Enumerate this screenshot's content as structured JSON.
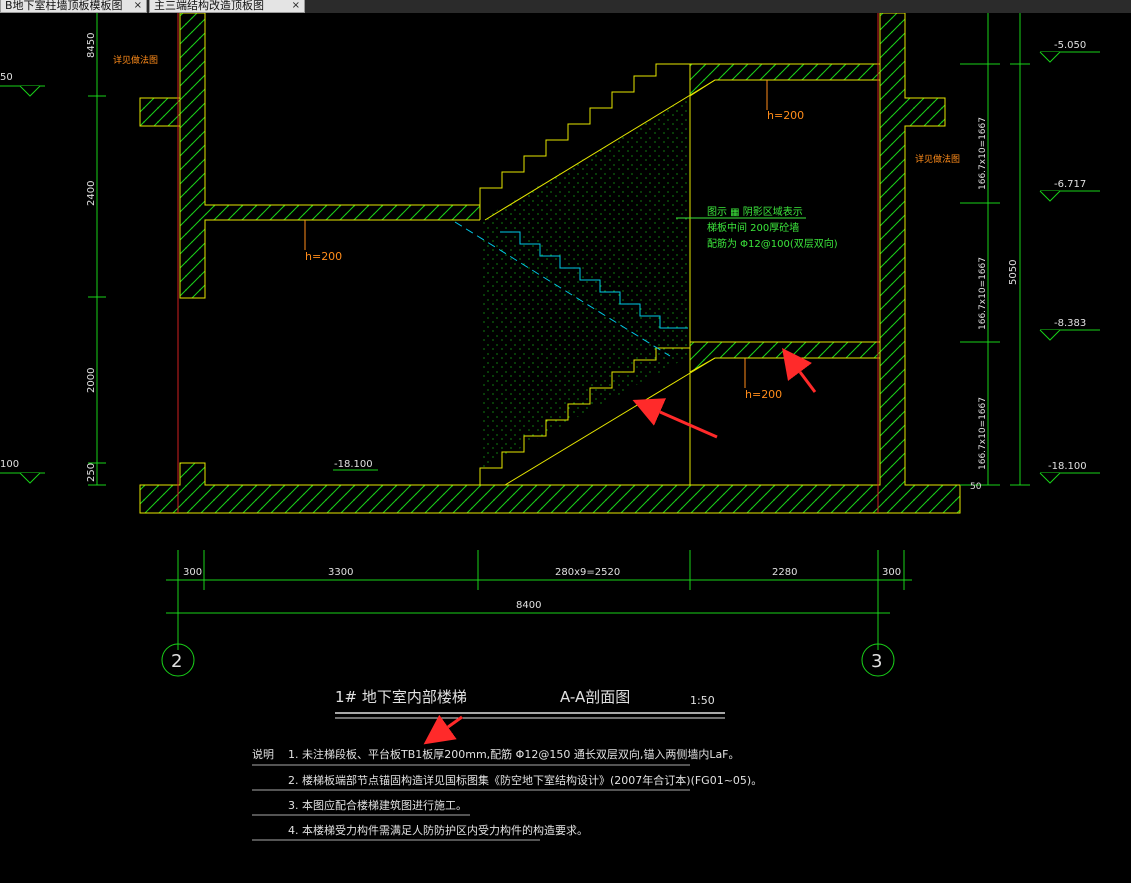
{
  "tabs": [
    {
      "label": "B地下室柱墙顶板模板图",
      "close": "×"
    },
    {
      "label": "主三端结构改造顶板图",
      "close": "×"
    }
  ],
  "colors": {
    "background": "#000000",
    "green_lines": "#19d219",
    "wall_yellow": "#e6e600",
    "dim_text": "#e0e0e0",
    "orange_text": "#ff8c1a",
    "cyan_dashed": "#00c8e6",
    "axis_red": "#d02020",
    "arrow_red": "#ff2a2a",
    "note_green": "#3ce63c"
  },
  "drawing": {
    "elevations": [
      "-5.050",
      "-6.717",
      "-8.383",
      "-18.100"
    ],
    "left_elev_top": "50",
    "left_elev_bottom": "100",
    "left_dims": [
      "8450",
      "2400",
      "2000",
      "250"
    ],
    "right_dims": [
      "166.7x10=1667",
      "166.7x10=1667",
      "166.7x10=1667",
      "5050",
      "50"
    ],
    "floor_level": "-18.100",
    "slab_labels": [
      "h=200",
      "h=200",
      "h=200"
    ],
    "detail_labels": [
      "详见做法图",
      "详见做法图"
    ],
    "fill_note": [
      "图示 ▦ 阴影区域表示",
      "梯板中间 200厚砼墙",
      "配筋为 Φ12@100(双层双向)"
    ],
    "bottom_dims": [
      "300",
      "3300",
      "280x9=2520",
      "2280",
      "300"
    ],
    "total_dim": "8400",
    "axes": [
      "2",
      "3"
    ],
    "title_left": "1# 地下室内部楼梯",
    "title_mid": "A-A剖面图",
    "title_scale": "1:50",
    "notes_head": "说明",
    "notes": [
      "1. 未注梯段板、平台板TB1板厚200mm,配筋 Φ12@150 通长双层双向,锚入两侧墙内LaF。",
      "2. 楼梯板端部节点锚固构造详见国标图集《防空地下室结构设计》(2007年合订本)(FG01~05)。",
      "3. 本图应配合楼梯建筑图进行施工。",
      "4. 本楼梯受力构件需满足人防防护区内受力构件的构造要求。"
    ]
  }
}
